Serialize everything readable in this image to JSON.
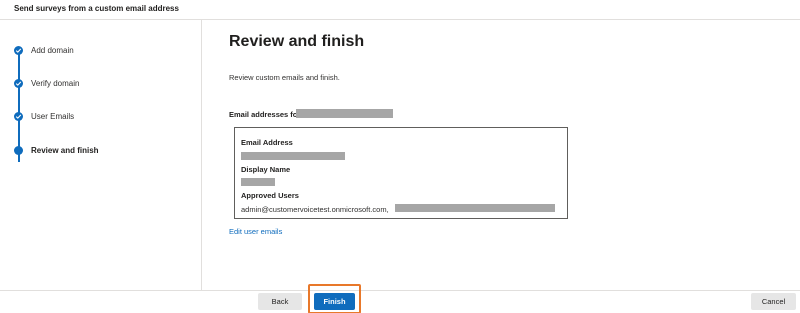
{
  "window": {
    "title": "Send surveys from a custom email address"
  },
  "steps": [
    {
      "label": "Add domain",
      "status": "completed"
    },
    {
      "label": "Verify domain",
      "status": "completed"
    },
    {
      "label": "User Emails",
      "status": "completed"
    },
    {
      "label": "Review and finish",
      "status": "current"
    }
  ],
  "main": {
    "title": "Review and finish",
    "subtitle": "Review custom emails and finish.",
    "emails_for_label": "Email addresses for",
    "details": {
      "email_address_label": "Email Address",
      "display_name_label": "Display Name",
      "approved_users_label": "Approved Users",
      "approved_users_value": "admin@customervoicetest.onmicrosoft.com,"
    },
    "edit_link": "Edit user emails"
  },
  "footer": {
    "back_label": "Back",
    "finish_label": "Finish",
    "cancel_label": "Cancel"
  },
  "colors": {
    "accent": "#0f6cbd",
    "highlight": "#e8782a",
    "redaction": "#a6a6a6"
  }
}
